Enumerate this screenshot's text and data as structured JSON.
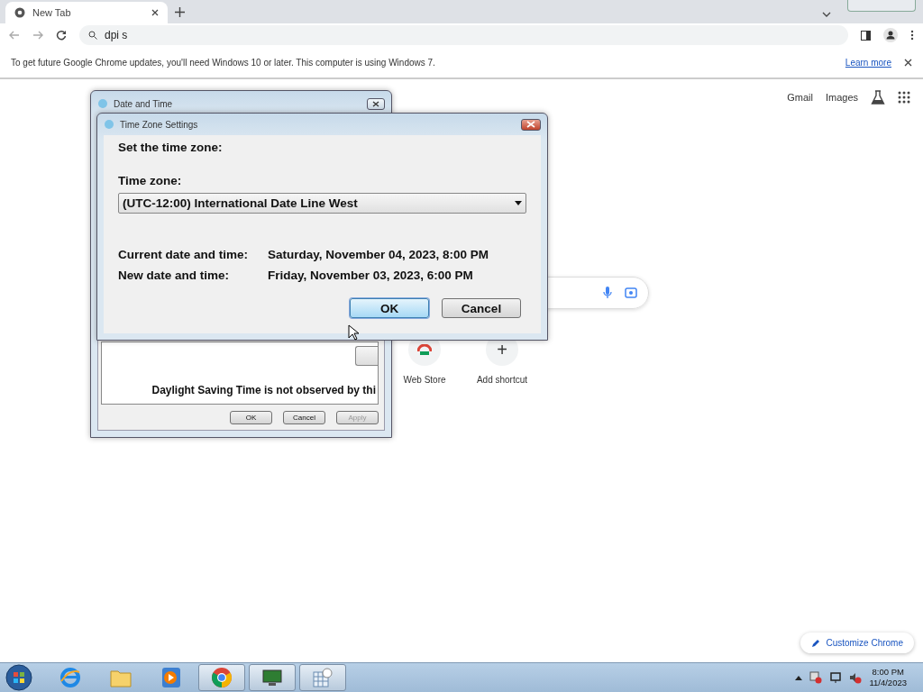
{
  "browser": {
    "tabs": [
      {
        "title": "New Tab",
        "selected": true
      }
    ],
    "address": "dpi s",
    "infobar": {
      "message": "To get future Google Chrome updates, you'll need Windows 10 or later. This computer is using Windows 7.",
      "link": "Learn more"
    }
  },
  "google": {
    "links": [
      "Gmail",
      "Images"
    ],
    "shortcuts": [
      {
        "kind": "store",
        "label": "Web Store"
      },
      {
        "kind": "add",
        "symbol": "+",
        "label": "Add shortcut"
      }
    ],
    "customize": "Customize Chrome"
  },
  "date_time_window": {
    "title": "Date and Time",
    "note": "Daylight Saving Time is not observed by thi",
    "buttons": [
      {
        "label": "OK",
        "disabled": false
      },
      {
        "label": "Cancel",
        "disabled": false
      },
      {
        "label": "Apply",
        "disabled": true
      }
    ]
  },
  "time_zone_dialog": {
    "title": "Time Zone Settings",
    "heading": "Set the time zone:",
    "zone_label": "Time zone:",
    "zone_value": "(UTC-12:00) International Date Line West",
    "rows": [
      {
        "label": "Current date and time:",
        "value": "Saturday, November 04, 2023, 8:00 PM"
      },
      {
        "label": "New date and time:",
        "value": "Friday, November 03, 2023, 6:00 PM"
      }
    ],
    "buttons": [
      {
        "label": "OK",
        "default": true
      },
      {
        "label": "Cancel",
        "default": false
      }
    ]
  },
  "taskbar": {
    "apps": [
      {
        "kind": "ie",
        "open": false
      },
      {
        "kind": "folder",
        "open": false
      },
      {
        "kind": "media",
        "open": false
      },
      {
        "kind": "chrome",
        "open": true
      },
      {
        "kind": "monitor",
        "open": true
      },
      {
        "kind": "calendar",
        "open": true
      }
    ],
    "clock": {
      "time": "8:00 PM",
      "date": "11/4/2023"
    }
  }
}
